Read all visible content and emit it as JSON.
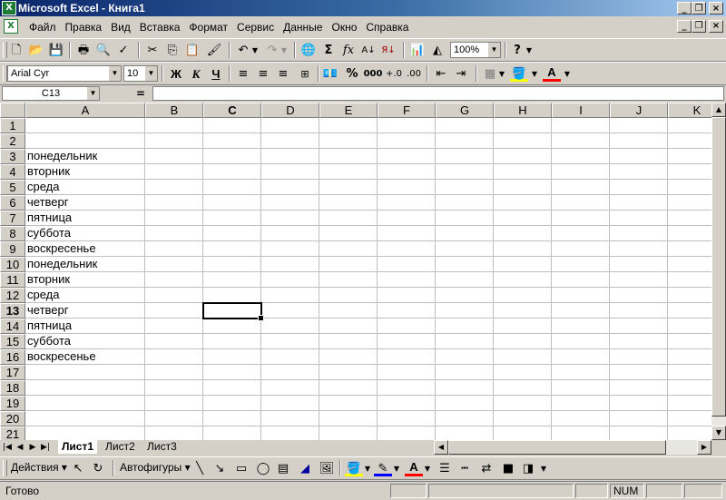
{
  "window": {
    "title": "Microsoft Excel - Книга1"
  },
  "menu": [
    "Файл",
    "Правка",
    "Вид",
    "Вставка",
    "Формат",
    "Сервис",
    "Данные",
    "Окно",
    "Справка"
  ],
  "standard_toolbar": {
    "zoom": "100%"
  },
  "format_toolbar": {
    "font": "Arial Cyr",
    "font_size": "10",
    "bold": "Ж",
    "italic": "К",
    "underline": "Ч",
    "percent": "%",
    "thousands": "000"
  },
  "formula_bar": {
    "name_box": "C13",
    "equals": "=",
    "formula": ""
  },
  "columns": [
    "A",
    "B",
    "C",
    "D",
    "E",
    "F",
    "G",
    "H",
    "I",
    "J",
    "K"
  ],
  "rows": [
    "1",
    "2",
    "3",
    "4",
    "5",
    "6",
    "7",
    "8",
    "9",
    "10",
    "11",
    "12",
    "13",
    "14",
    "15",
    "16",
    "17",
    "18",
    "19",
    "20",
    "21"
  ],
  "active_cell": {
    "column": "C",
    "row": "13"
  },
  "column_a_values": {
    "3": "понедельник",
    "4": "вторник",
    "5": "среда",
    "6": "четверг",
    "7": "пятница",
    "8": "суббота",
    "9": "воскресенье",
    "10": "понедельник",
    "11": "вторник",
    "12": "среда",
    "13": "четверг",
    "14": "пятница",
    "15": "суббота",
    "16": "воскресенье"
  },
  "sheets": {
    "tab1": "Лист1",
    "tab2": "Лист2",
    "tab3": "Лист3",
    "active": "Лист1"
  },
  "drawing_toolbar": {
    "actions": "Действия",
    "autoshapes": "Автофигуры"
  },
  "status_bar": {
    "text": "Готово",
    "num": "NUM"
  }
}
